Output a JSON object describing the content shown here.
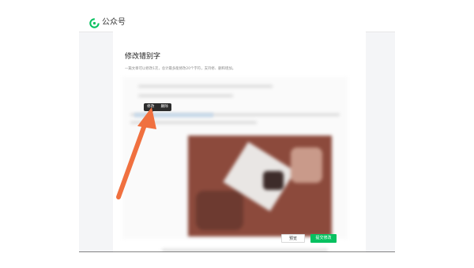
{
  "header": {
    "app_name": "公众号"
  },
  "page": {
    "title": "修改错别字",
    "description": "一篇文章可以修改1次，总计最多能修改20个字符，支持修、删和增加。"
  },
  "popup": {
    "edit_label": "修改",
    "delete_label": "删除"
  },
  "footer": {
    "preview_label": "预览",
    "submit_label": "提交修改"
  },
  "colors": {
    "brand": "#07c160",
    "arrow": "#f0703f"
  }
}
